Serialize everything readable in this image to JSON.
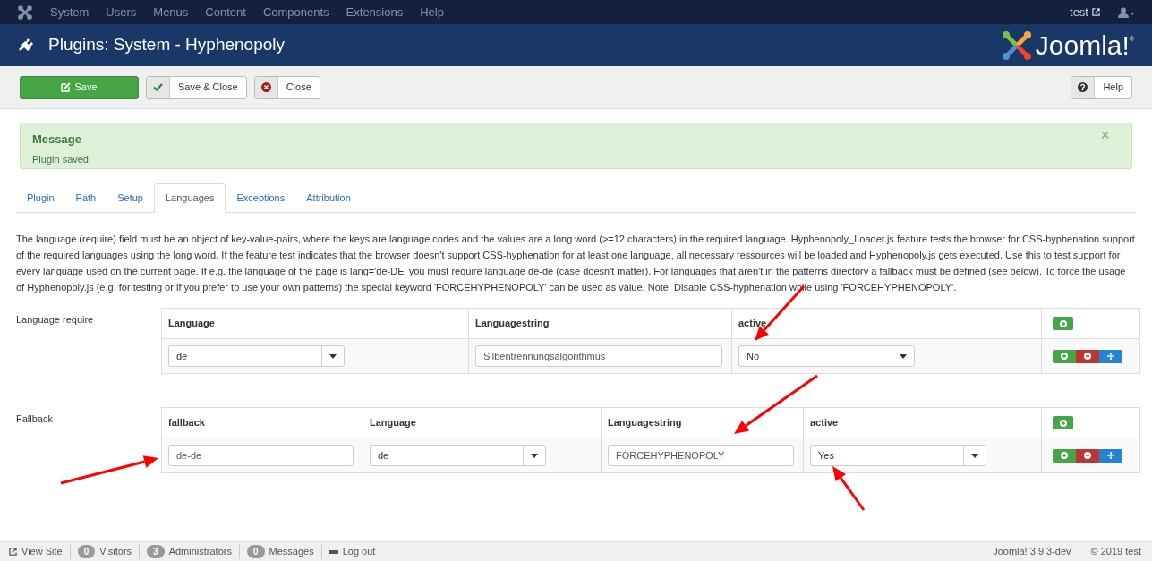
{
  "topnav": {
    "menu": [
      "System",
      "Users",
      "Menus",
      "Content",
      "Components",
      "Extensions",
      "Help"
    ],
    "user": "test"
  },
  "header": {
    "title": "Plugins: System - Hyphenopoly",
    "logo_text": "Joomla!",
    "logo_mark": "®"
  },
  "toolbar": {
    "buttons": [
      {
        "label": "Save",
        "kind": "primary"
      },
      {
        "label": "Save & Close",
        "kind": "check"
      },
      {
        "label": "Close",
        "kind": "close"
      }
    ],
    "help": "Help"
  },
  "message": {
    "title": "Message",
    "text": "Plugin saved.",
    "close": "×"
  },
  "tabs": [
    {
      "label": "Plugin",
      "selected": false
    },
    {
      "label": "Path",
      "selected": false
    },
    {
      "label": "Setup",
      "selected": false
    },
    {
      "label": "Languages",
      "selected": true
    },
    {
      "label": "Exceptions",
      "selected": false
    },
    {
      "label": "Attribution",
      "selected": false
    }
  ],
  "description": "The language (require) field must be an object of key-value-pairs, where the keys are language codes and the values are a long word (>=12 characters) in the required language. Hyphenopoly_Loader.js feature tests the browser for CSS-hyphenation support of the required languages using the long word. If the feature test indicates that the browser doesn't support CSS-hyphenation for at least one language, all necessary ressources will be loaded and Hyphenopoly.js gets executed. Use this to test support for every language used on the current page. If e.g. the language of the page is lang='de-DE' you must require language de-de (case doesn't matter). For languages that aren't in the patterns directory a fallback must be defined (see below). To force the usage of Hyphenopoly.js (e.g. for testing or if you prefer to use your own patterns) the special keyword 'FORCEHYPHENOPOLY' can be used as value. Note: Disable CSS-hyphenation while using 'FORCEHYPHENOPOLY'.",
  "fields": [
    {
      "label": "Language require",
      "columns": [
        {
          "title": "Language",
          "kind": "select"
        },
        {
          "title": "Languagestring",
          "kind": "text"
        },
        {
          "title": "active",
          "kind": "select"
        }
      ],
      "rows": [
        [
          "de",
          "Silbentrennungsalgorithmus",
          "No"
        ]
      ]
    },
    {
      "label": "Fallback",
      "columns": [
        {
          "title": "fallback",
          "kind": "text"
        },
        {
          "title": "Language",
          "kind": "select"
        },
        {
          "title": "Languagestring",
          "kind": "text"
        },
        {
          "title": "active",
          "kind": "select"
        }
      ],
      "rows": [
        [
          "de-de",
          "de",
          "FORCEHYPHENOPOLY",
          "Yes"
        ]
      ]
    }
  ],
  "footer": {
    "items": [
      {
        "label": "View Site",
        "kind": "link"
      },
      {
        "label": "Visitors",
        "badge": "0",
        "kind": "badge"
      },
      {
        "label": "Administrators",
        "badge": "3",
        "kind": "badge"
      },
      {
        "label": "Messages",
        "badge": "0",
        "kind": "badge"
      },
      {
        "label": "Log out",
        "kind": "logout"
      }
    ],
    "version": "Joomla! 3.9.3-dev",
    "copyright": "© 2019 test"
  }
}
